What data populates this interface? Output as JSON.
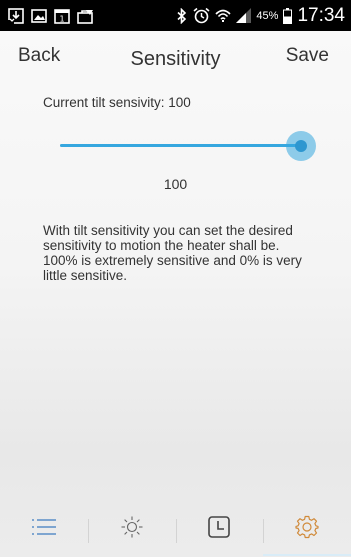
{
  "status_bar": {
    "icons_left": [
      "download-icon",
      "image-icon",
      "calendar-icon",
      "briefcase-icon"
    ],
    "icons_right": [
      "bluetooth-icon",
      "alarm-icon",
      "wifi-icon",
      "signal-icon",
      "battery-icon"
    ],
    "battery_percent": "45%",
    "time": "17:34"
  },
  "header": {
    "back_label": "Back",
    "title": "Sensitivity",
    "save_label": "Save"
  },
  "sensitivity": {
    "current_label": "Current tilt sensivity: 100",
    "value": 100,
    "value_text": "100",
    "min": 0,
    "max": 100,
    "accent_color": "#36a7df"
  },
  "description": {
    "line1": "With tilt sensitivity you can set the desired sensitivity to motion the heater shall be.",
    "line2": "100% is extremely sensitive and 0% is very little sensitive."
  },
  "bottom_nav": {
    "tabs": [
      {
        "icon": "list-icon",
        "active": false
      },
      {
        "icon": "sun-icon",
        "active": false
      },
      {
        "icon": "clock-icon",
        "active": false
      },
      {
        "icon": "settings-gear-icon",
        "active": true
      }
    ],
    "active_color": "#d08a3a"
  }
}
